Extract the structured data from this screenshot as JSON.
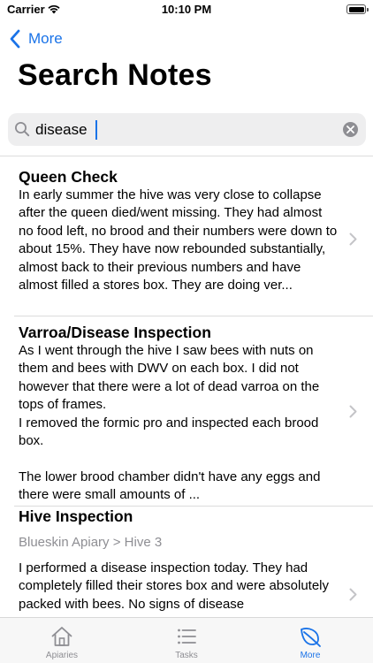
{
  "status_bar": {
    "carrier": "Carrier",
    "time": "10:10 PM"
  },
  "nav": {
    "back_label": "More"
  },
  "title": "Search Notes",
  "search": {
    "value": "disease"
  },
  "notes": [
    {
      "title": "Queen Check",
      "body": "In early summer the hive was very close to collapse after the queen died/went missing. They had almost no food left, no brood and their numbers were down to about 15%. They have now rebounded substantially, almost back to their previous numbers and have almost filled a stores box. They are doing ver..."
    },
    {
      "title": "Varroa/Disease Inspection",
      "body": "As I went through the hive I saw bees with nuts on them and bees with DWV on each box. I did not however that there were a lot of dead varroa on the tops of frames.\nI removed the formic pro and inspected each brood box.\n\nThe lower brood chamber didn't have any eggs and there were small amounts of ..."
    },
    {
      "title": "Hive Inspection",
      "subtitle": "Blueskin Apiary > Hive 3",
      "body": "I performed a disease inspection today. They had completely filled their stores box and were absolutely packed with bees. No signs of disease"
    }
  ],
  "tabs": [
    {
      "label": "Apiaries",
      "icon": "house-icon"
    },
    {
      "label": "Tasks",
      "icon": "list-icon"
    },
    {
      "label": "More",
      "icon": "leaf-icon",
      "active": true
    }
  ],
  "colors": {
    "accent": "#1a73e8",
    "inactive": "#8e8e93"
  }
}
